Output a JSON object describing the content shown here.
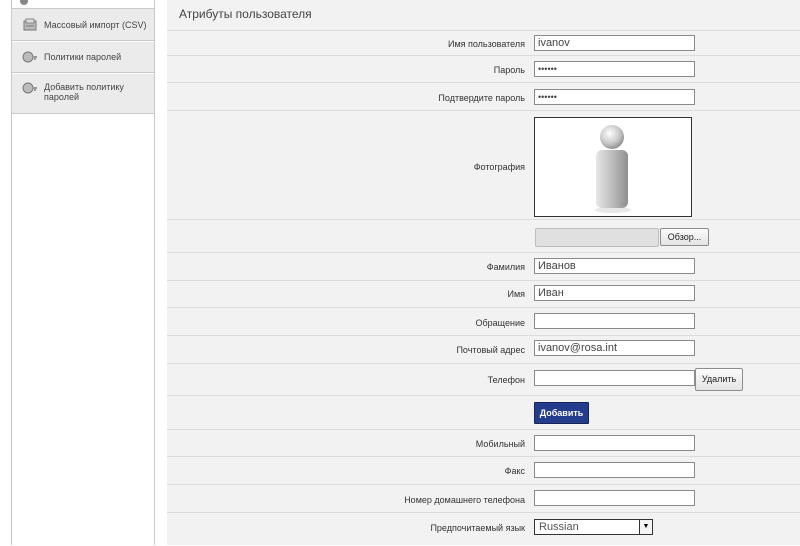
{
  "sidebar": {
    "items": [
      {
        "label": "Массовый импорт (CSV)",
        "icon": "import-icon"
      },
      {
        "label": "Политики паролей",
        "icon": "password-policy-icon"
      },
      {
        "label": "Добавить политику паролей",
        "icon": "add-policy-icon"
      }
    ]
  },
  "section": {
    "title": "Атрибуты пользователя"
  },
  "form": {
    "username": {
      "label": "Имя пользователя",
      "value": "ivanov"
    },
    "password": {
      "label": "Пароль",
      "value": "••••••"
    },
    "confirm": {
      "label": "Подтвердите пароль",
      "value": "••••••"
    },
    "photo": {
      "label": "Фотография",
      "browse": "Обзор..."
    },
    "lastname": {
      "label": "Фамилия",
      "value": "Иванов"
    },
    "firstname": {
      "label": "Имя",
      "value": "Иван"
    },
    "salutation": {
      "label": "Обращение",
      "value": ""
    },
    "email": {
      "label": "Почтовый адрес",
      "value": "ivanov@rosa.int"
    },
    "phone": {
      "label": "Телефон",
      "value": "",
      "remove": "Удалить"
    },
    "add_button": "Добавить",
    "mobile": {
      "label": "Мобильный",
      "value": ""
    },
    "fax": {
      "label": "Факс",
      "value": ""
    },
    "home_phone": {
      "label": "Номер домашнего телефона",
      "value": ""
    },
    "language": {
      "label": "Предпочитаемый язык",
      "value": "Russian"
    }
  }
}
